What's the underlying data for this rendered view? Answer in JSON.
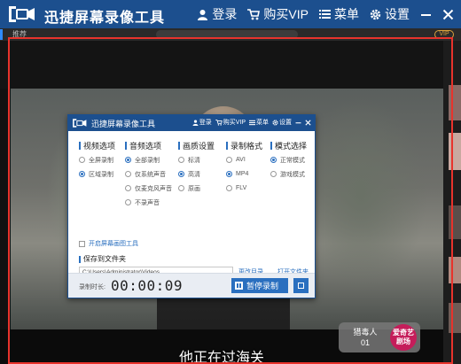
{
  "app": {
    "title": "迅捷屏幕录像工具",
    "nav": {
      "login": "登录",
      "vip": "购买VIP",
      "menu": "菜单",
      "settings": "设置"
    }
  },
  "browser": {
    "tab_label": "推荐",
    "vip_badge": "VIP"
  },
  "video": {
    "subtitle": "他正在过海关",
    "badge_title": "猎毒人",
    "badge_episode": "01",
    "badge_logo_text": "爱奇艺 剧场"
  },
  "recorder": {
    "title": "迅捷屏幕录像工具",
    "nav": {
      "login": "登录",
      "vip": "购买VIP",
      "menu": "菜单",
      "settings": "设置"
    },
    "sections": {
      "video": {
        "label": "视频选项",
        "options": [
          "全屏录制",
          "区域录制"
        ],
        "selected": "区域录制"
      },
      "audio": {
        "label": "音频选项",
        "options": [
          "全部录制",
          "仅系统声音",
          "仅麦克风声音",
          "不录声音"
        ],
        "selected": "全部录制"
      },
      "quality": {
        "label": "画质设置",
        "options": [
          "标清",
          "高清",
          "原画"
        ],
        "selected": "高清"
      },
      "format": {
        "label": "录制格式",
        "options": [
          "AVI",
          "MP4",
          "FLV"
        ],
        "selected": "MP4"
      },
      "mode": {
        "label": "模式选择",
        "options": [
          "正常模式",
          "游戏模式"
        ],
        "selected": "正常模式"
      }
    },
    "brush_tool_label": "开启屏幕画图工具",
    "save_label": "保存到文件夹",
    "save_path": "C:\\Users\\Administrator\\Videos",
    "change_dir": "更改目录",
    "open_folder": "打开文件夹",
    "duration_label": "录制时长:",
    "duration": "00:00:09",
    "pause_label": "暂停录制"
  },
  "colors": {
    "titlebar": "#1c4f8e",
    "accent": "#2a6fbf",
    "selection": "#e8332c"
  },
  "icons": [
    "app-logo-icon",
    "user-icon",
    "cart-icon",
    "menu-icon",
    "gear-icon",
    "minimize-icon",
    "close-icon",
    "pause-icon",
    "stop-icon"
  ]
}
